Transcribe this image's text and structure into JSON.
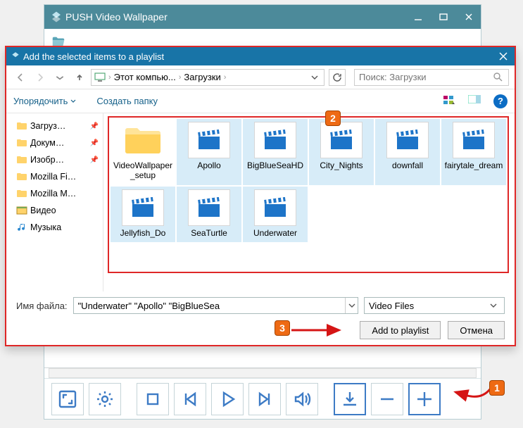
{
  "outer": {
    "title": "PUSH Video Wallpaper"
  },
  "dialog": {
    "title": "Add the selected items to a playlist",
    "breadcrumb": {
      "item1": "Этот компью...",
      "item2": "Загрузки"
    },
    "search_placeholder": "Поиск: Загрузки",
    "toolbar": {
      "organize": "Упорядочить",
      "newfolder": "Создать папку"
    },
    "footer": {
      "filename_label": "Имя файла:",
      "filename_value": "\"Underwater\" \"Apollo\" \"BigBlueSea",
      "filter": "Video Files",
      "add": "Add to playlist",
      "cancel": "Отмена"
    }
  },
  "sidebar": {
    "items": [
      {
        "label": "Загруз…",
        "pin": true,
        "icon": "folder"
      },
      {
        "label": "Докум…",
        "pin": true,
        "icon": "folder"
      },
      {
        "label": "Изобр…",
        "pin": true,
        "icon": "folder"
      },
      {
        "label": "Mozilla Fi…",
        "pin": false,
        "icon": "folder"
      },
      {
        "label": "Mozilla M…",
        "pin": false,
        "icon": "folder"
      },
      {
        "label": "Видео",
        "pin": false,
        "icon": "video"
      },
      {
        "label": "Музыка",
        "pin": false,
        "icon": "music"
      }
    ]
  },
  "files": [
    {
      "name": "VideoWallpaper_setup",
      "type": "folder",
      "selected": false
    },
    {
      "name": "Apollo",
      "type": "video",
      "selected": true
    },
    {
      "name": "BigBlueSeaHD",
      "type": "video",
      "selected": true
    },
    {
      "name": "City_Nights",
      "type": "video",
      "selected": true
    },
    {
      "name": "downfall",
      "type": "video",
      "selected": true
    },
    {
      "name": "fairytale_dream",
      "type": "video",
      "selected": true
    },
    {
      "name": "Jellyfish_Do",
      "type": "video",
      "selected": true
    },
    {
      "name": "SeaTurtle",
      "type": "video",
      "selected": true
    },
    {
      "name": "Underwater",
      "type": "video",
      "selected": true
    }
  ],
  "callouts": {
    "c1": "1",
    "c2": "2",
    "c3": "3"
  }
}
